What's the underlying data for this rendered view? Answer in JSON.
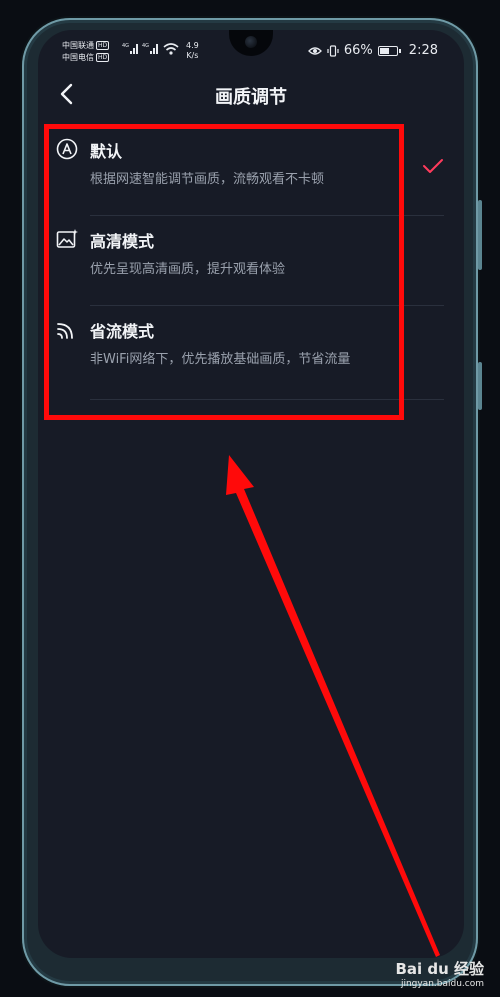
{
  "status_bar": {
    "carrier_1": "中国联通",
    "carrier_2": "中国电信",
    "hd_badge": "HD",
    "network_1": "4G",
    "network_2": "4G",
    "speed_value": "4.9",
    "speed_unit": "K/s",
    "battery": "66%",
    "battery_level": 0.66,
    "time": "2:28"
  },
  "header": {
    "title": "画质调节",
    "back_icon": "chevron-left-icon"
  },
  "options": [
    {
      "icon": "auto-a-icon",
      "label": "默认",
      "description": "根据网速智能调节画质，流畅观看不卡顿",
      "selected": true
    },
    {
      "icon": "hd-image-icon",
      "label": "高清模式",
      "description": "优先呈现高清画质，提升观看体验",
      "selected": false
    },
    {
      "icon": "data-saver-icon",
      "label": "省流模式",
      "description": "非WiFi网络下，优先播放基础画质，节省流量",
      "selected": false
    }
  ],
  "colors": {
    "background": "#171b26",
    "accent": "#ff3b5c",
    "annotation": "#ff0a0a"
  },
  "watermark": {
    "logo": "Bai du 经验",
    "url": "jingyan.baidu.com"
  }
}
